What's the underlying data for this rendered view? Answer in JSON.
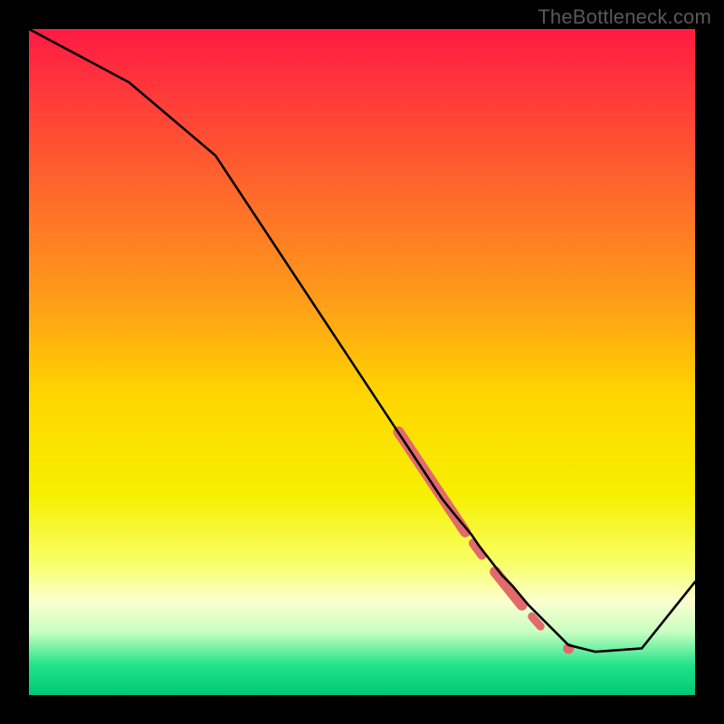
{
  "watermark": "TheBottleneck.com",
  "gradient": {
    "stops": [
      {
        "offset": 0.0,
        "color": "#ff1a43"
      },
      {
        "offset": 0.1,
        "color": "#ff3a3a"
      },
      {
        "offset": 0.25,
        "color": "#ff6a2a"
      },
      {
        "offset": 0.4,
        "color": "#ff9a1a"
      },
      {
        "offset": 0.55,
        "color": "#ffd500"
      },
      {
        "offset": 0.7,
        "color": "#f6f000"
      },
      {
        "offset": 0.8,
        "color": "#f8ff66"
      },
      {
        "offset": 0.86,
        "color": "#fbffd0"
      },
      {
        "offset": 0.905,
        "color": "#c8ffc0"
      },
      {
        "offset": 0.955,
        "color": "#22e38a"
      },
      {
        "offset": 1.0,
        "color": "#00c876"
      }
    ]
  },
  "chart_data": {
    "type": "line",
    "title": "",
    "xlabel": "",
    "ylabel": "",
    "xlim": [
      0,
      100
    ],
    "ylim": [
      0,
      100
    ],
    "series": [
      {
        "name": "curve",
        "x": [
          0,
          15,
          28,
          62,
          64,
          66.5,
          67.5,
          71,
          72.5,
          75,
          76.5,
          81,
          85,
          92,
          100
        ],
        "y": [
          100,
          92,
          81,
          29.5,
          27,
          24,
          22.5,
          18,
          16.5,
          13.5,
          12,
          7.5,
          6.5,
          7,
          17
        ]
      }
    ],
    "highlight_segments": [
      {
        "x0": 55.5,
        "y0": 39.5,
        "x1": 65.5,
        "y1": 24.5,
        "w": 12
      },
      {
        "x0": 66.7,
        "y0": 22.8,
        "x1": 68.0,
        "y1": 21.0,
        "w": 10
      },
      {
        "x0": 70.0,
        "y0": 18.5,
        "x1": 74.0,
        "y1": 13.5,
        "w": 12
      },
      {
        "x0": 75.5,
        "y0": 11.8,
        "x1": 76.8,
        "y1": 10.3,
        "w": 9
      }
    ],
    "highlight_dots": [
      {
        "x": 81.0,
        "y": 7.0,
        "r": 6
      }
    ],
    "highlight_color": "#e26a6a"
  }
}
